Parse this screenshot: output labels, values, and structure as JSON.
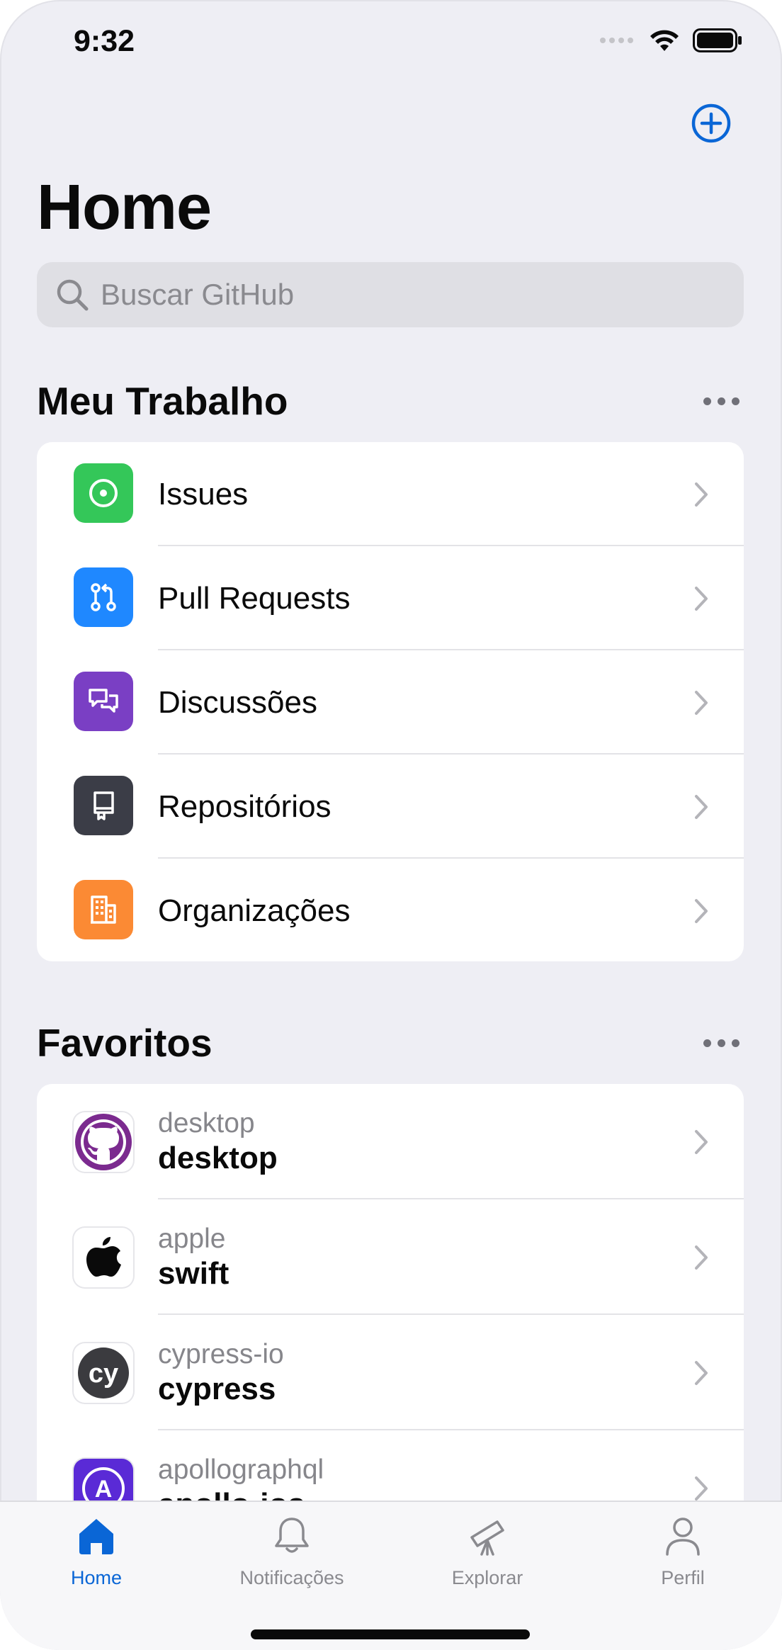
{
  "status": {
    "time": "9:32"
  },
  "header": {
    "title": "Home"
  },
  "search": {
    "placeholder": "Buscar GitHub"
  },
  "my_work": {
    "title": "Meu Trabalho",
    "items": [
      {
        "label": "Issues",
        "icon": "issue-opened-icon",
        "color": "#34c759"
      },
      {
        "label": "Pull Requests",
        "icon": "git-pull-request-icon",
        "color": "#1f88ff"
      },
      {
        "label": "Discussões",
        "icon": "discussions-icon",
        "color": "#7a3fc4"
      },
      {
        "label": "Repositórios",
        "icon": "repo-icon",
        "color": "#3b3d47"
      },
      {
        "label": "Organizações",
        "icon": "organization-icon",
        "color": "#fb8a34"
      }
    ]
  },
  "favorites": {
    "title": "Favoritos",
    "items": [
      {
        "owner": "desktop",
        "repo": "desktop",
        "icon": "github-octocat-icon"
      },
      {
        "owner": "apple",
        "repo": "swift",
        "icon": "apple-logo-icon"
      },
      {
        "owner": "cypress-io",
        "repo": "cypress",
        "icon": "cypress-logo-icon",
        "logo_text": "cy"
      },
      {
        "owner": "apollographql",
        "repo": "apollo-ios",
        "icon": "apollo-logo-icon",
        "logo_text": "A"
      }
    ]
  },
  "tabs": [
    {
      "label": "Home",
      "icon": "home-icon",
      "active": true
    },
    {
      "label": "Notificações",
      "icon": "bell-icon",
      "active": false
    },
    {
      "label": "Explorar",
      "icon": "telescope-icon",
      "active": false
    },
    {
      "label": "Perfil",
      "icon": "person-icon",
      "active": false
    }
  ],
  "colors": {
    "accent": "#0a66d6",
    "background": "#eeeef4"
  }
}
